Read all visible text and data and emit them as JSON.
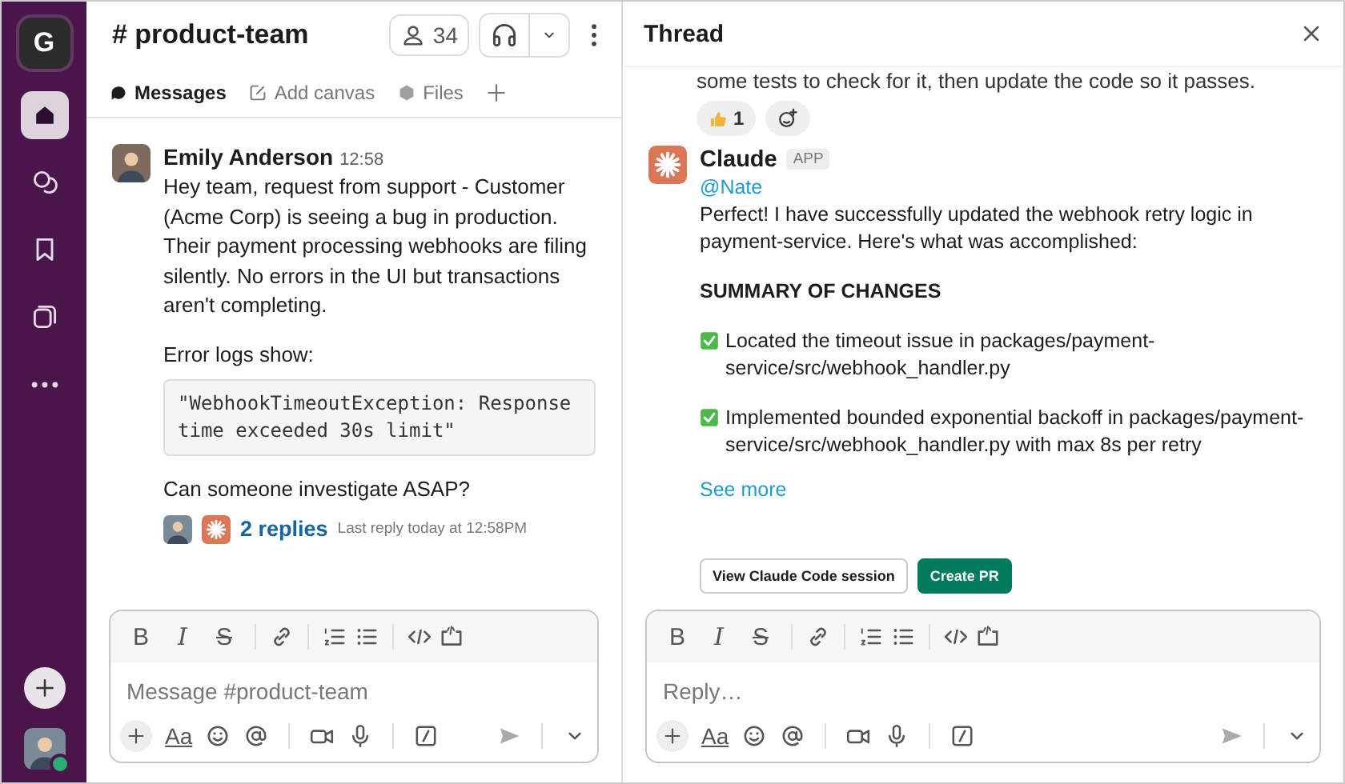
{
  "workspace": {
    "initial": "G"
  },
  "sidebar": {
    "items": [
      {
        "kind": "home",
        "selected": true
      },
      {
        "kind": "dms",
        "selected": false
      },
      {
        "kind": "bookmark",
        "selected": false
      },
      {
        "kind": "files",
        "selected": false
      },
      {
        "kind": "more",
        "selected": false
      }
    ]
  },
  "channel": {
    "name": "# product-team",
    "members": "34",
    "tabs": [
      {
        "label": "Messages",
        "kind": "messages",
        "selected": true
      },
      {
        "label": "Add canvas",
        "kind": "canvas",
        "selected": false
      },
      {
        "label": "Files",
        "kind": "files",
        "selected": false
      }
    ]
  },
  "message": {
    "author": "Emily Anderson",
    "time": "12:58",
    "text": "Hey team, request from support - Customer (Acme Corp) is seeing a bug in production. Their payment processing webhooks are filing silently. No errors in the UI but transactions aren't completing.",
    "intro": "Error logs show:",
    "code": "\"WebhookTimeoutException: Response time exceeded 30s limit\"",
    "question": "Can someone investigate ASAP?",
    "replies": "2 replies",
    "last_reply": "Last reply today at 12:58PM"
  },
  "composer": {
    "format": [
      "B",
      "I",
      "S"
    ],
    "placeholder": "Message #product-team",
    "text_style": "Aa"
  },
  "thread": {
    "title": "Thread",
    "previous_text": "some tests to check for it, then update the code so it passes.",
    "reactions": [
      {
        "count": "1"
      }
    ],
    "reply": {
      "author": "Claude",
      "badge": "APP",
      "mention": "@Nate",
      "text": "Perfect! I have successfully updated the webhook retry logic in payment-service. Here's what was accomplished:",
      "heading": "SUMMARY OF CHANGES",
      "items": [
        "Located the timeout issue in packages/payment-service/src/webhook_handler.py",
        "Implemented bounded exponential backoff in packages/payment-service/src/webhook_handler.py with max 8s per retry"
      ],
      "see_more": "See more",
      "buttons": [
        {
          "label": "View Claude Code session",
          "kind": "secondary"
        },
        {
          "label": "Create PR",
          "kind": "primary"
        }
      ]
    },
    "composer": {
      "format": [
        "B",
        "I",
        "S"
      ],
      "placeholder": "Reply…",
      "text_style": "Aa"
    }
  }
}
